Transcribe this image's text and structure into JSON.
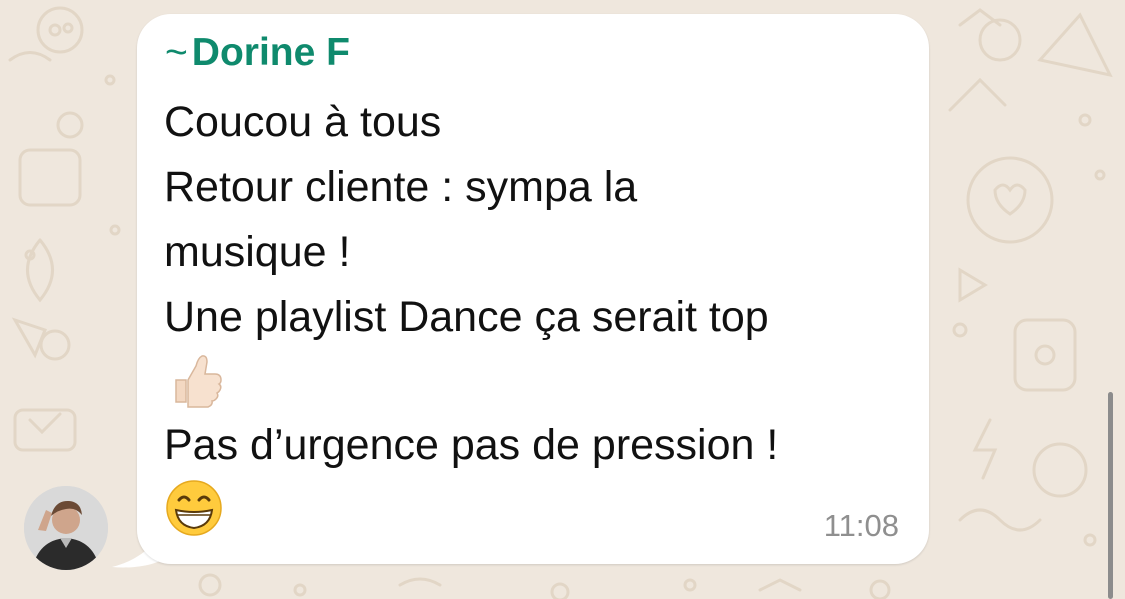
{
  "message": {
    "sender_prefix": "~",
    "sender_name": "Dorine F",
    "sender_color": "#0f8a6d",
    "lines": [
      "Coucou à tous",
      "Retour cliente : sympa la",
      "musique !",
      "Une playlist Dance ça serait top",
      "Pas d’urgence pas de pression !"
    ],
    "emoji_thumbs": "thumbs-up-light-skin-tone",
    "emoji_smile": "beaming-face-with-smiling-eyes",
    "time": "11:08"
  },
  "colors": {
    "wallpaper": "#efe7dd",
    "bubble": "#ffffff",
    "text": "#111111",
    "time": "#8f8f8f"
  }
}
